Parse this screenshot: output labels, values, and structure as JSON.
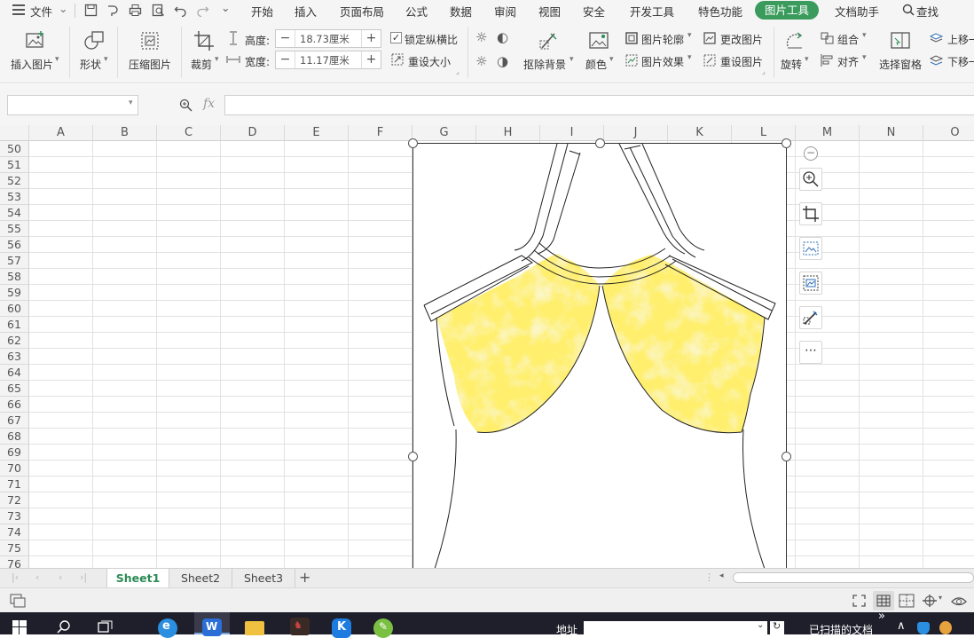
{
  "menubar": {
    "file_menu": "文件",
    "tabs": [
      "开始",
      "插入",
      "页面布局",
      "公式",
      "数据",
      "审阅",
      "视图",
      "安全",
      "开发工具",
      "特色功能",
      "图片工具",
      "文档助手"
    ],
    "active_tab": "图片工具",
    "search_label": "查找"
  },
  "ribbon": {
    "insert_picture": "插入图片",
    "shape": "形状",
    "compress_picture": "压缩图片",
    "crop": "裁剪",
    "height_label": "高度:",
    "height_value": "18.73厘米",
    "width_label": "宽度:",
    "width_value": "11.17厘米",
    "lock_ratio": "锁定纵横比",
    "reset_size": "重设大小",
    "remove_background": "抠除背景",
    "color": "颜色",
    "picture_outline": "图片轮廓",
    "picture_effect": "图片效果",
    "change_picture": "更改图片",
    "reset_picture": "重设图片",
    "rotate": "旋转",
    "group": "组合",
    "align": "对齐",
    "selection_pane": "选择窗格",
    "bring_forward": "上移一",
    "send_backward": "下移一"
  },
  "formula_bar": {
    "name_box": "",
    "fx": "fx",
    "formula": ""
  },
  "grid": {
    "columns": [
      "A",
      "B",
      "C",
      "D",
      "E",
      "F",
      "G",
      "H",
      "I",
      "J",
      "K",
      "L",
      "M",
      "N",
      "O"
    ],
    "rows": [
      "50",
      "51",
      "52",
      "53",
      "54",
      "55",
      "56",
      "57",
      "58",
      "59",
      "60",
      "61",
      "62",
      "63",
      "64",
      "65",
      "66",
      "67",
      "68",
      "69",
      "70",
      "71",
      "72",
      "73",
      "74",
      "75",
      "76"
    ]
  },
  "sheets": {
    "tabs": [
      "Sheet1",
      "Sheet2",
      "Sheet3"
    ],
    "active": "Sheet1",
    "add": "+"
  },
  "taskbar": {
    "address_label": "地址",
    "scanned_docs": "已扫描的文档",
    "overflow": "»"
  },
  "colors": {
    "accent_green": "#3a9b5c",
    "fabric_yellow": "#f0dc2a",
    "taskbar_bg": "#1f1f2b"
  }
}
